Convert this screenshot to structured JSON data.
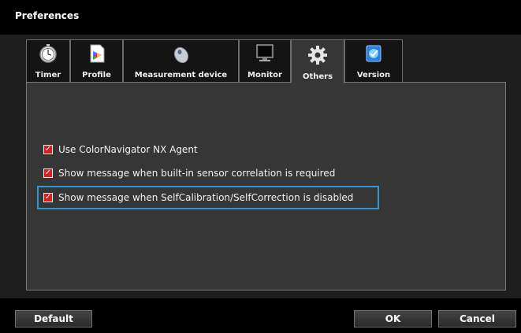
{
  "window": {
    "title": "Preferences"
  },
  "tabs": [
    {
      "label": "Timer",
      "icon": "stopwatch-icon"
    },
    {
      "label": "Profile",
      "icon": "profile-document-icon"
    },
    {
      "label": "Measurement device",
      "icon": "mouse-sensor-icon"
    },
    {
      "label": "Monitor",
      "icon": "monitor-icon"
    },
    {
      "label": "Others",
      "icon": "gear-icon",
      "active": true
    },
    {
      "label": "Version",
      "icon": "version-icon"
    }
  ],
  "options": [
    {
      "label": "Use ColorNavigator NX Agent",
      "checked": true
    },
    {
      "label": "Show message when built-in sensor correlation is required",
      "checked": true
    },
    {
      "label": "Show message when SelfCalibration/SelfCorrection is disabled",
      "checked": true,
      "focused": true
    }
  ],
  "buttons": {
    "default": "Default",
    "ok": "OK",
    "cancel": "Cancel"
  },
  "colors": {
    "checkbox": "#d82020",
    "focus_ring": "#2c9ad6",
    "panel": "#363636"
  }
}
